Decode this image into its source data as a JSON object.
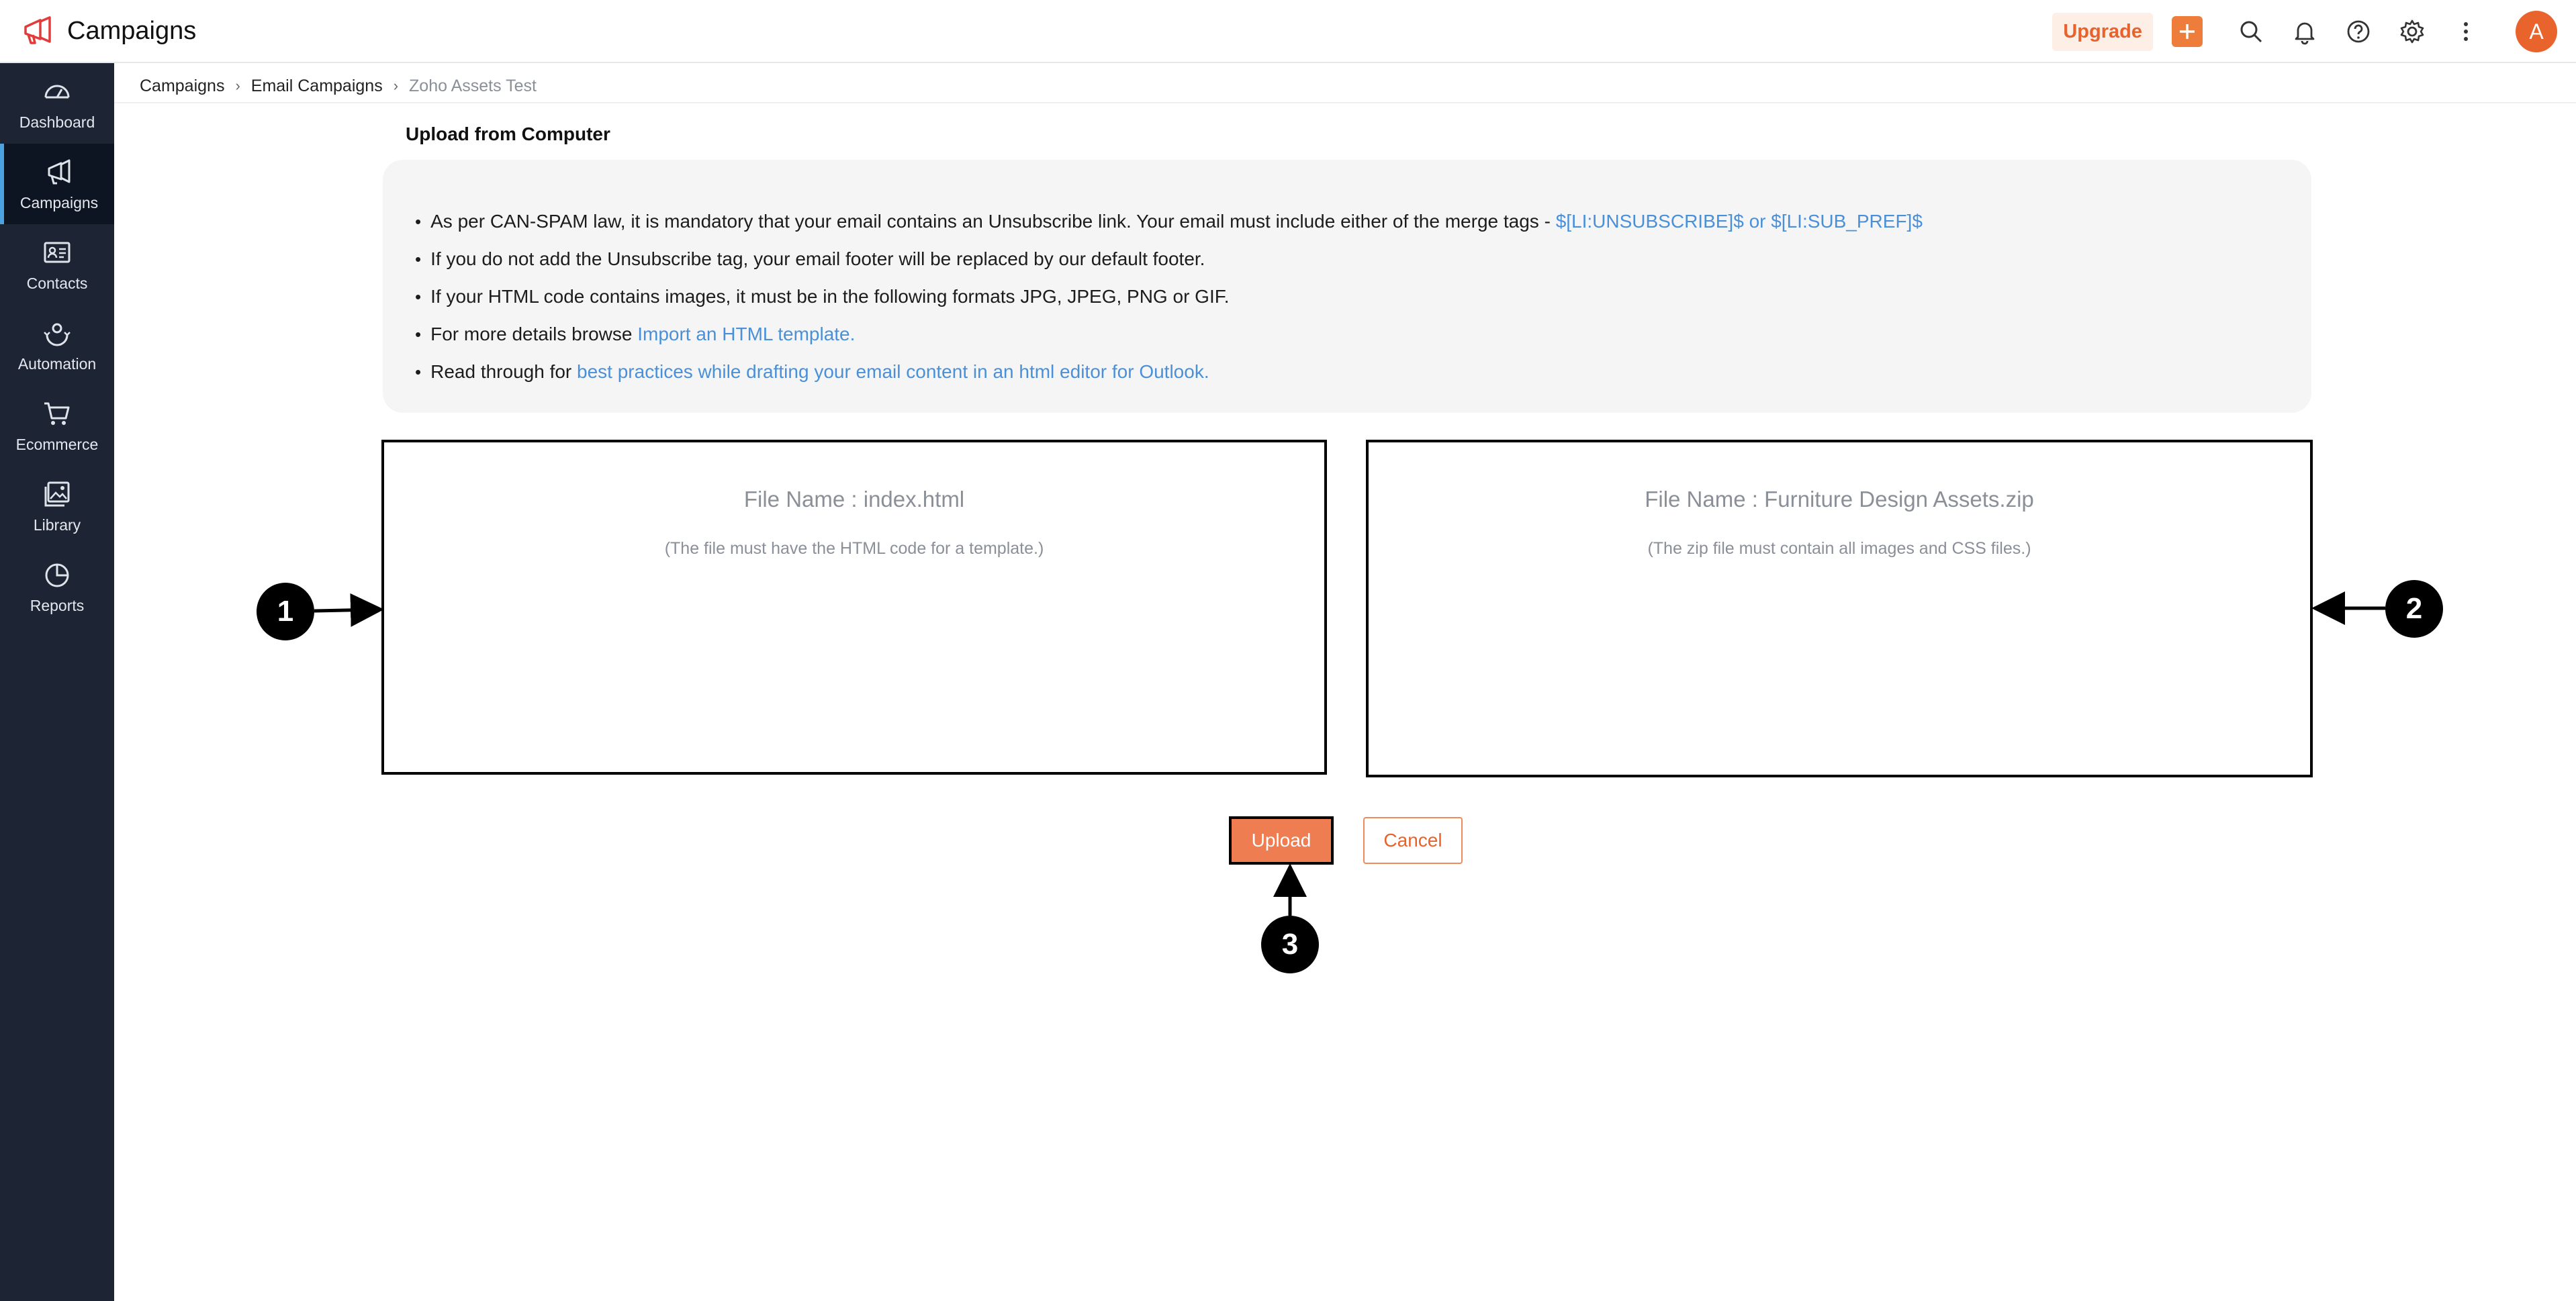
{
  "app": {
    "title": "Campaigns"
  },
  "header": {
    "upgrade_label": "Upgrade",
    "avatar_initial": "A",
    "icons": [
      "plus-icon",
      "search-icon",
      "bell-icon",
      "help-icon",
      "gear-icon",
      "more-vertical-icon"
    ],
    "accent_color": "#ee7d3c"
  },
  "sidebar": {
    "items": [
      {
        "label": "Dashboard",
        "icon": "dashboard-icon"
      },
      {
        "label": "Campaigns",
        "icon": "megaphone-icon",
        "active": true
      },
      {
        "label": "Contacts",
        "icon": "contact-card-icon"
      },
      {
        "label": "Automation",
        "icon": "automation-icon"
      },
      {
        "label": "Ecommerce",
        "icon": "cart-icon"
      },
      {
        "label": "Library",
        "icon": "image-library-icon"
      },
      {
        "label": "Reports",
        "icon": "pie-chart-icon"
      }
    ]
  },
  "breadcrumb": [
    "Campaigns",
    "Email Campaigns",
    "Zoho Assets Test"
  ],
  "section_title": "Upload from Computer",
  "info": {
    "line1_text": "As per CAN-SPAM law, it is mandatory that your email contains an Unsubscribe link. Your email must include either of the merge tags - ",
    "line1_link": "$[LI:UNSUBSCRIBE]$ or $[LI:SUB_PREF]$",
    "line2_text": "If you do not add the Unsubscribe tag, your email footer will be replaced by our default footer.",
    "line3_text": "If your HTML code contains images, it must be in the following formats JPG, JPEG, PNG or GIF.",
    "line4_text": "For more details browse ",
    "line4_link": "Import an HTML template.",
    "line5_text": "Read through for ",
    "line5_link": "best practices while drafting your email content in an html editor for Outlook."
  },
  "uploads": {
    "html_file": {
      "name": "File Name : index.html",
      "hint": "(The file must have the HTML code for a template.)"
    },
    "zip_file": {
      "name": "File Name : Furniture Design Assets.zip",
      "hint": "(The zip file must contain all images and CSS files.)"
    }
  },
  "actions": {
    "upload_label": "Upload",
    "cancel_label": "Cancel"
  },
  "callouts": [
    "1",
    "2",
    "3"
  ]
}
